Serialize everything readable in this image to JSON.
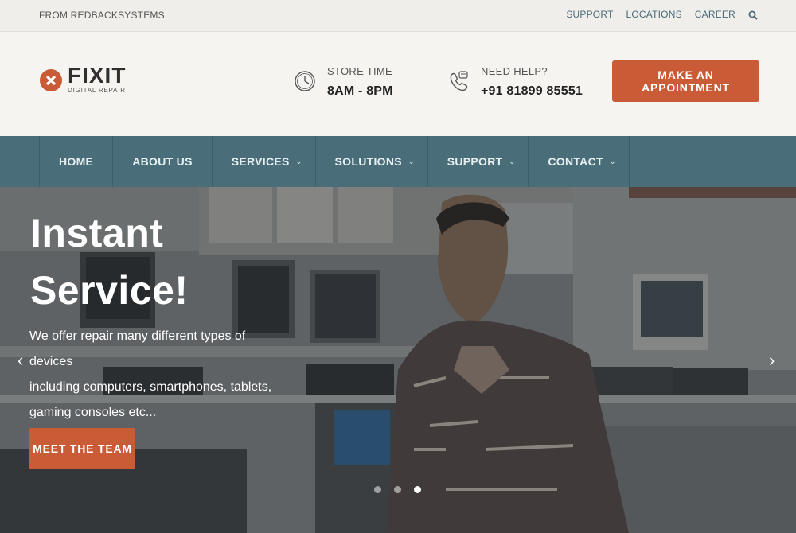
{
  "topbar": {
    "from": "FROM REDBACKSYSTEMS",
    "links": [
      "SUPPORT",
      "LOCATIONS",
      "CAREER"
    ],
    "search_icon": "search-icon"
  },
  "header": {
    "logo_name": "FIXIT",
    "logo_sub": "DIGITAL REPAIR",
    "store": {
      "label": "STORE TIME",
      "value": "8AM - 8PM",
      "icon": "clock-icon"
    },
    "help": {
      "label": "NEED HELP?",
      "value": "+91 81899 85551",
      "icon": "phone-icon"
    },
    "appointment_label": "MAKE AN APPOINTMENT"
  },
  "nav": {
    "items": [
      {
        "label": "HOME",
        "dropdown": false
      },
      {
        "label": "ABOUT US",
        "dropdown": false
      },
      {
        "label": "SERVICES",
        "dropdown": true
      },
      {
        "label": "SOLUTIONS",
        "dropdown": true
      },
      {
        "label": "SUPPORT",
        "dropdown": true
      },
      {
        "label": "CONTACT",
        "dropdown": true
      }
    ]
  },
  "hero": {
    "line1": "Instant",
    "line2": "Service!",
    "desc1": "We offer repair many different types of devices",
    "desc2": "including computers, smartphones, tablets,",
    "desc3": "gaming consoles etc...",
    "button": "MEET THE TEAM",
    "prev": "‹",
    "next": "›",
    "slides": 3,
    "active_slide": 3
  },
  "colors": {
    "accent": "#c95c37",
    "nav": "#496e79"
  }
}
